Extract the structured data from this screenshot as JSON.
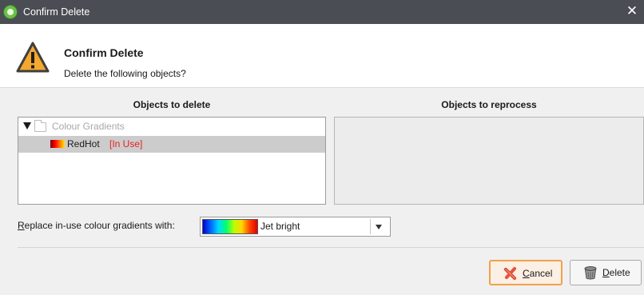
{
  "window": {
    "title": "Confirm Delete",
    "close_glyph": "✕"
  },
  "header": {
    "title": "Confirm Delete",
    "subtitle": "Delete the following objects?",
    "icon": "warning-icon"
  },
  "columns": {
    "delete_heading": "Objects to delete",
    "reprocess_heading": "Objects to reprocess"
  },
  "delete_tree": {
    "group_label": "Colour Gradients",
    "items": [
      {
        "label": "RedHot",
        "status": "[In Use]",
        "status_color": "#e32222"
      }
    ]
  },
  "replace": {
    "label_mnemonic": "R",
    "label_rest": "eplace in-use colour gradients with:",
    "selected_value": "Jet bright"
  },
  "buttons": {
    "cancel_mnemonic": "C",
    "cancel_rest": "ancel",
    "delete_mnemonic": "D",
    "delete_rest": "elete"
  },
  "colors": {
    "titlebar": "#4a4d53",
    "body_bg": "#f0f0f0",
    "cancel_accent": "#f0a14a",
    "selected_row": "#cccccc"
  }
}
